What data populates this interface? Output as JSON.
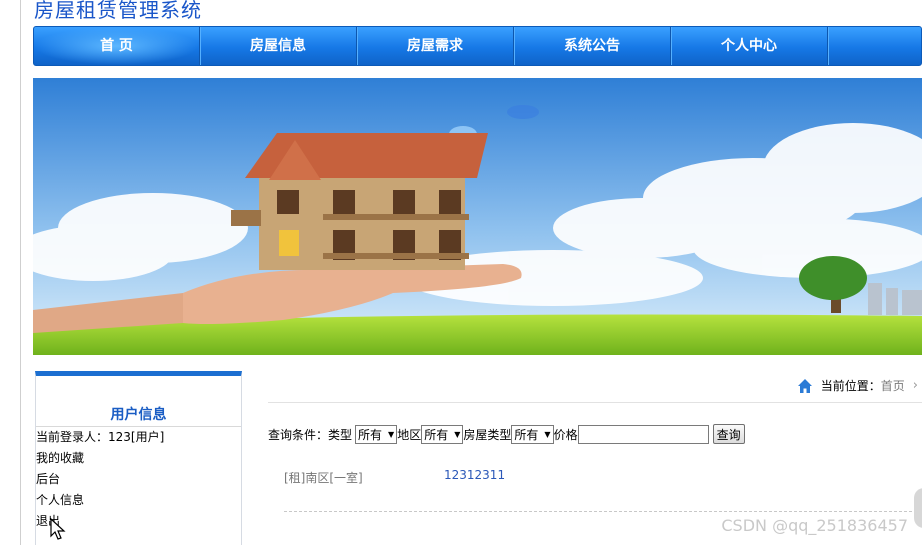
{
  "site": {
    "title": "房屋租赁管理系统"
  },
  "nav": {
    "items": [
      "首 页",
      "房屋信息",
      "房屋需求",
      "系统公告",
      "个人中心"
    ],
    "colors": {
      "bar": "#1678e6"
    }
  },
  "sidebar": {
    "title": "用户信息",
    "items": [
      "当前登录人：123[用户]",
      "我的收藏",
      "后台",
      "个人信息",
      "退出"
    ]
  },
  "breadcrumb": {
    "label": "当前位置：",
    "home": "首页",
    "icon": "home-icon"
  },
  "search": {
    "prefix": "查询条件：",
    "type_label": "类型",
    "type_value": "所有",
    "area_label": "地区",
    "area_value": "所有",
    "house_type_label": "房屋类型",
    "house_type_value": "所有",
    "price_label": "价格",
    "price_value": "",
    "button": "查询"
  },
  "results": [
    {
      "title": "[租]南区[一室]",
      "price": "12312311"
    }
  ],
  "watermark": "CSDN @qq_251836457"
}
